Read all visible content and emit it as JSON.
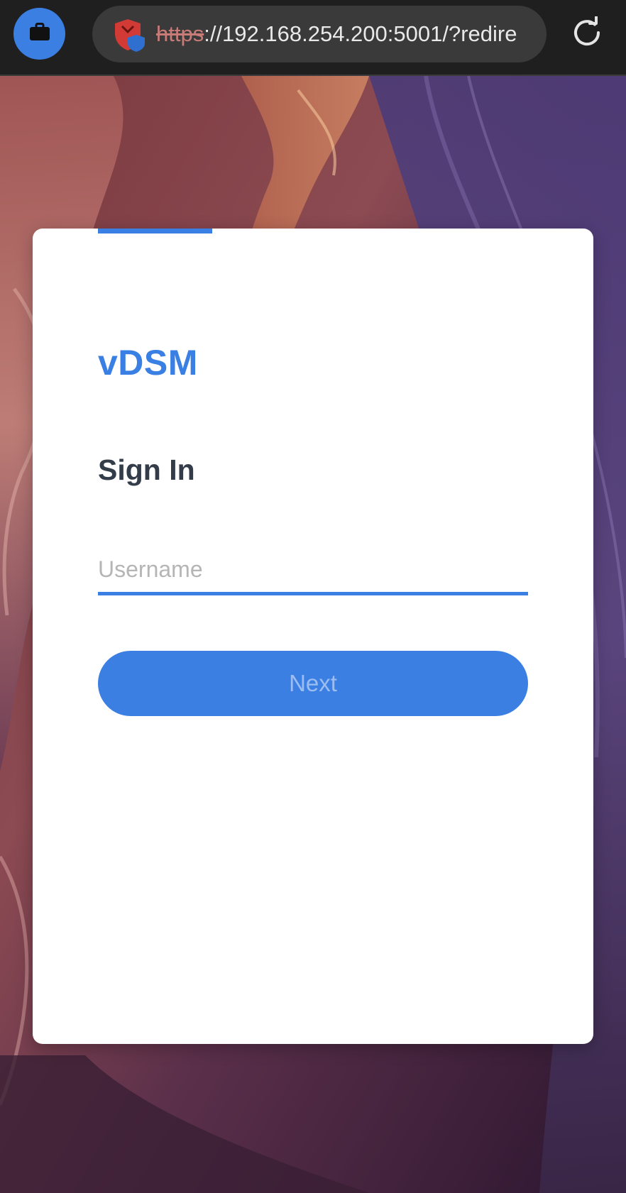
{
  "browser": {
    "url_scheme": "https",
    "url_rest": "://192.168.254.200:5001/?redire",
    "work_profile_icon": "briefcase-icon",
    "security_icon": "shield-warning-icon",
    "reload_icon": "reload-icon"
  },
  "login": {
    "brand": "vDSM",
    "heading": "Sign In",
    "username_placeholder": "Username",
    "username_value": "",
    "next_label": "Next"
  },
  "colors": {
    "accent": "#3a7fe3",
    "heading": "#333d4a",
    "browser_bar": "#1f1f1f"
  }
}
